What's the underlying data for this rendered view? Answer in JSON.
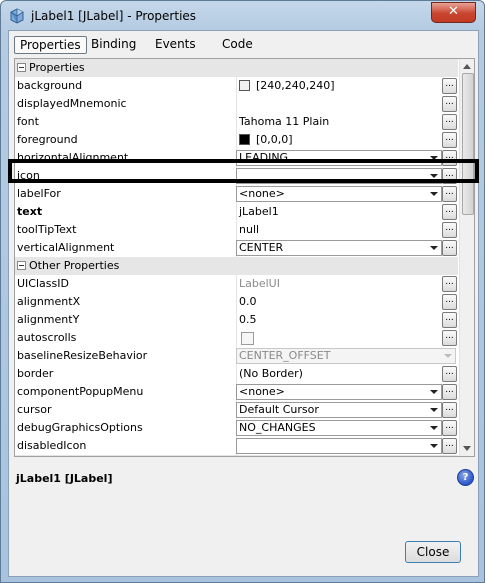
{
  "window": {
    "title": "jLabel1 [JLabel] - Properties",
    "close_glyph": "✕"
  },
  "tabs": [
    {
      "label": "Properties",
      "active": true
    },
    {
      "label": "Binding",
      "active": false
    },
    {
      "label": "Events",
      "active": false
    },
    {
      "label": "Code",
      "active": false
    }
  ],
  "categories": {
    "properties": "Properties",
    "other": "Other Properties"
  },
  "properties": [
    {
      "name": "background",
      "value": "[240,240,240]",
      "swatch": "#f0f0f0"
    },
    {
      "name": "displayedMnemonic",
      "value": ""
    },
    {
      "name": "font",
      "value": "Tahoma 11 Plain"
    },
    {
      "name": "foreground",
      "value": "[0,0,0]",
      "swatch": "#000000"
    },
    {
      "name": "horizontalAlignment",
      "value": "LEADING"
    },
    {
      "name": "icon",
      "value": ""
    },
    {
      "name": "labelFor",
      "value": "<none>"
    },
    {
      "name": "text",
      "value": "jLabel1"
    },
    {
      "name": "toolTipText",
      "value": "null"
    },
    {
      "name": "verticalAlignment",
      "value": "CENTER"
    }
  ],
  "other_properties": [
    {
      "name": "UIClassID",
      "value": "LabelUI"
    },
    {
      "name": "alignmentX",
      "value": "0.0"
    },
    {
      "name": "alignmentY",
      "value": "0.5"
    },
    {
      "name": "autoscrolls",
      "value": ""
    },
    {
      "name": "baselineResizeBehavior",
      "value": "CENTER_OFFSET"
    },
    {
      "name": "border",
      "value": "(No Border)"
    },
    {
      "name": "componentPopupMenu",
      "value": "<none>"
    },
    {
      "name": "cursor",
      "value": "Default Cursor"
    },
    {
      "name": "debugGraphicsOptions",
      "value": "NO_CHANGES"
    },
    {
      "name": "disabledIcon",
      "value": ""
    }
  ],
  "ellipsis": "...",
  "description": {
    "title": "jLabel1 [JLabel]",
    "help_glyph": "?"
  },
  "buttons": {
    "close": "Close"
  }
}
